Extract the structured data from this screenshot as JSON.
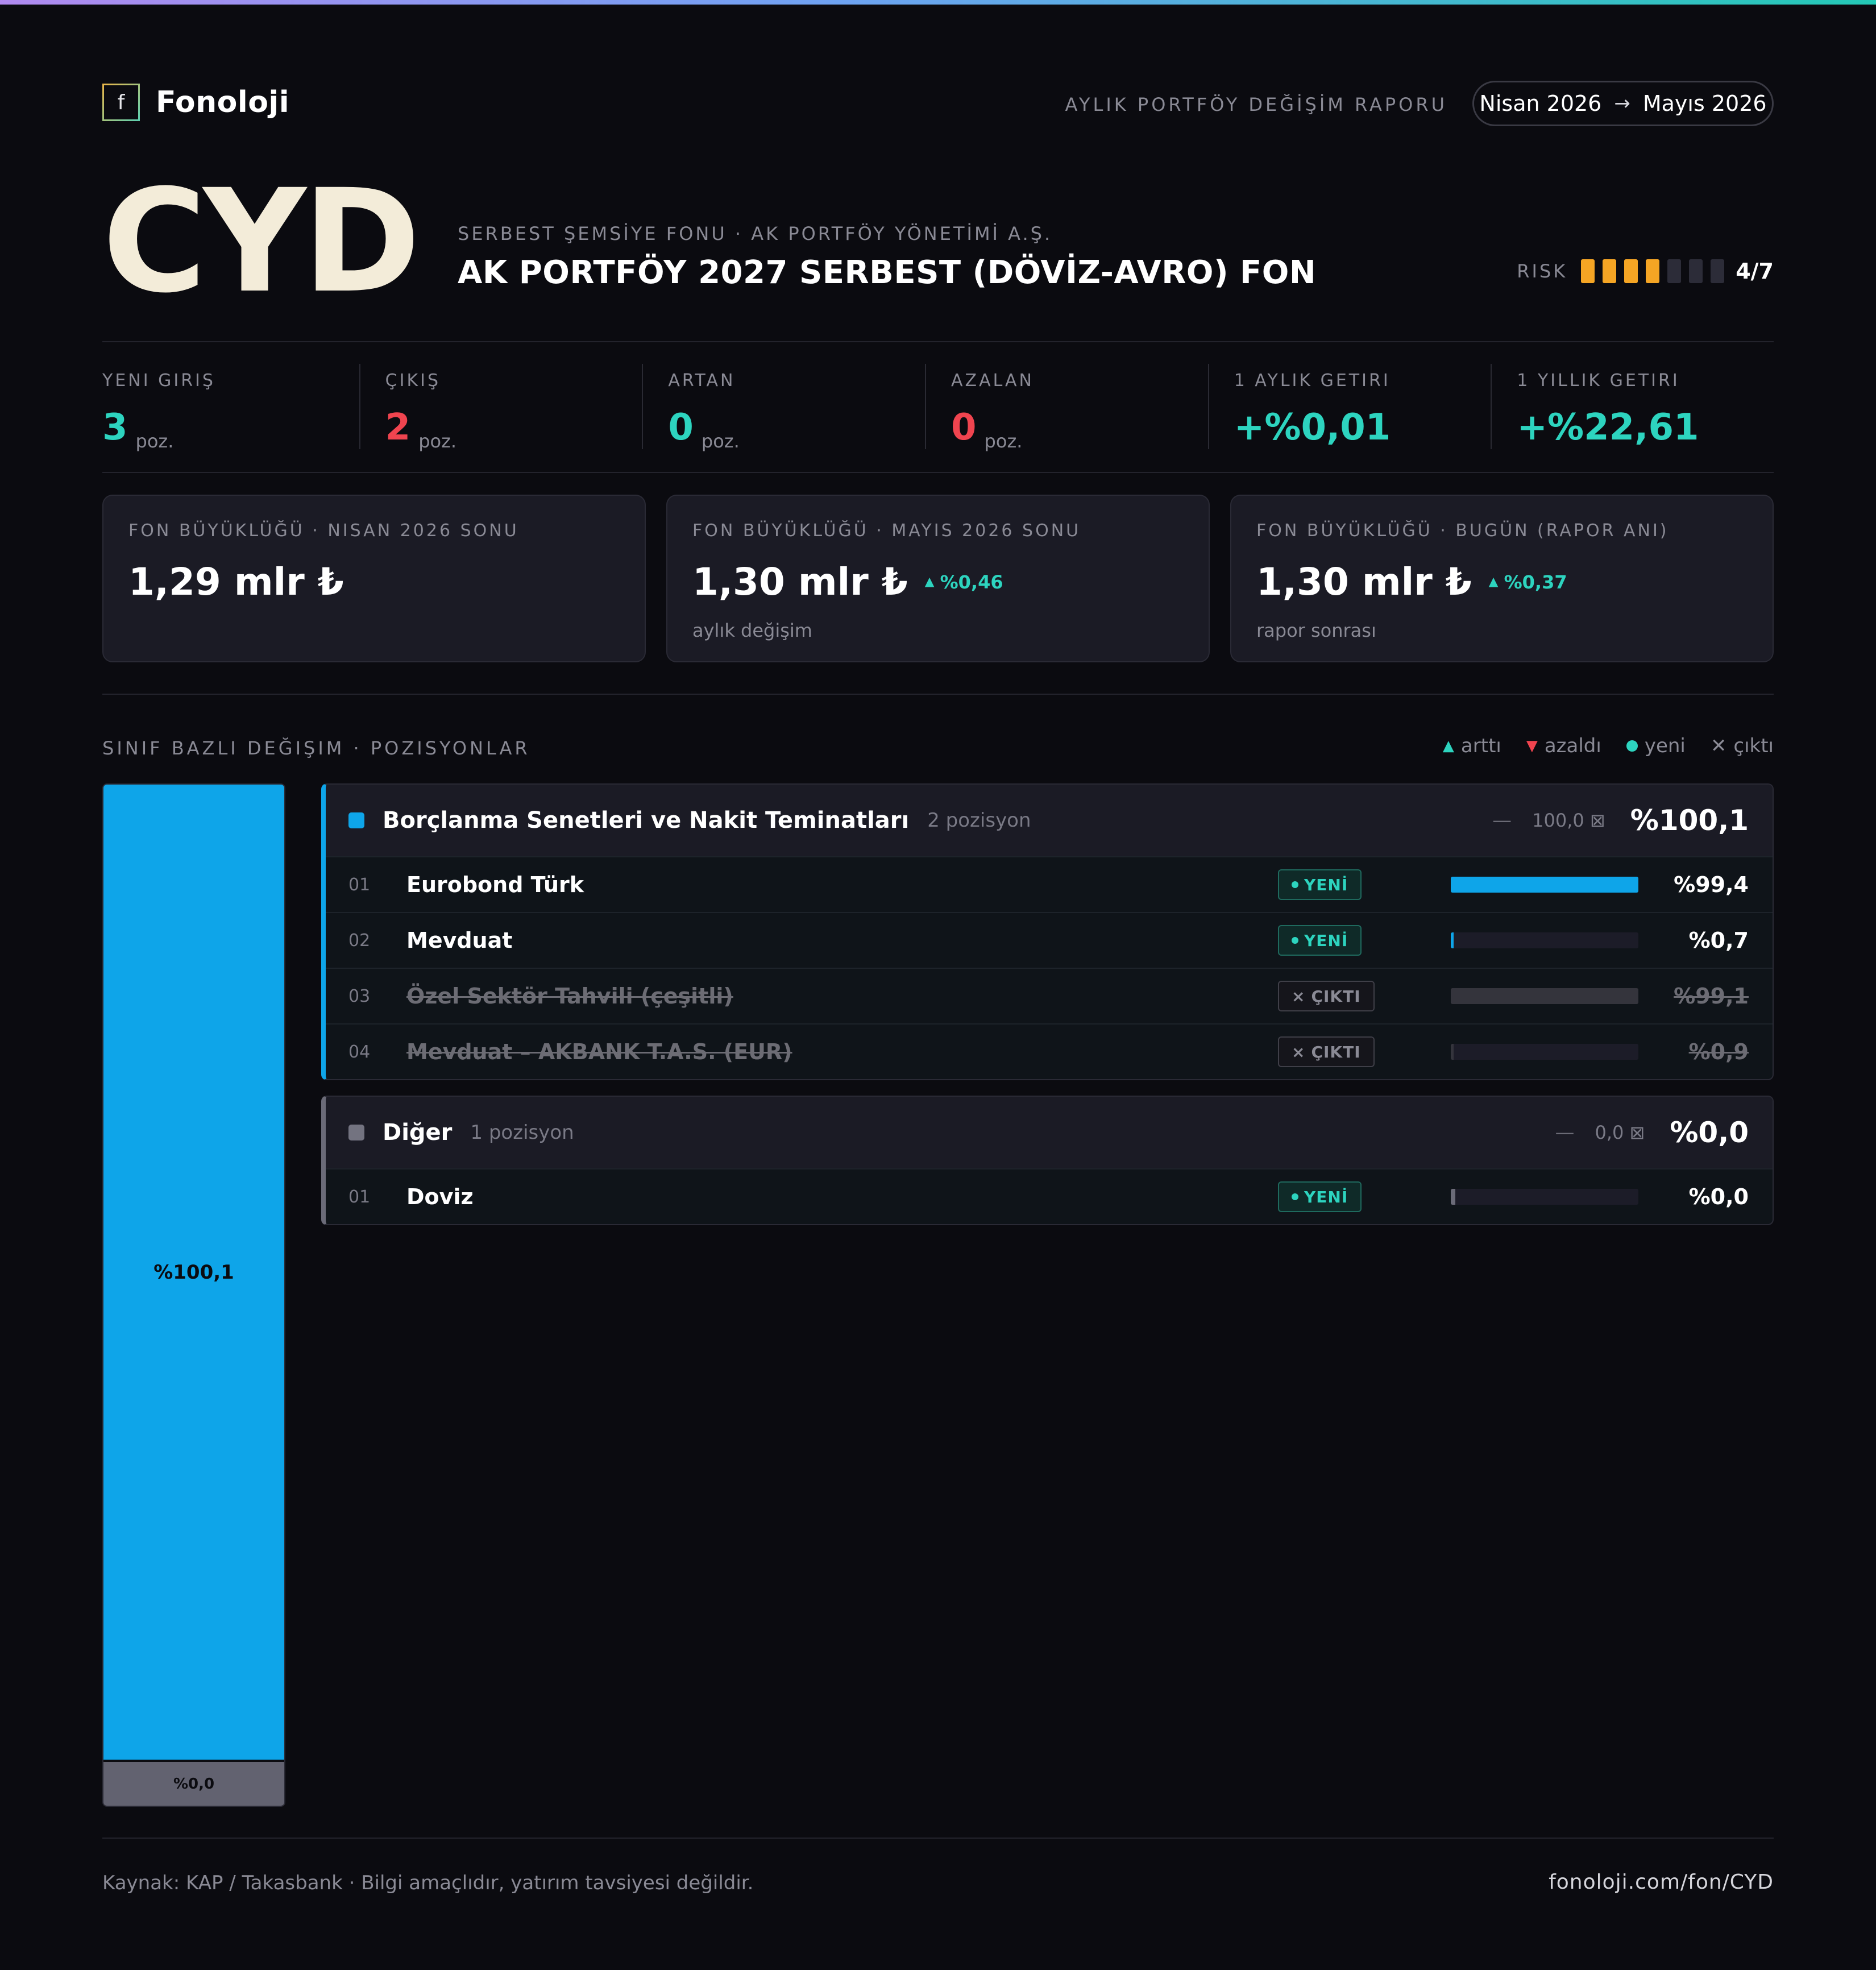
{
  "header": {
    "brand_mark": "f",
    "brand_name": "Fonoloji",
    "report_label": "AYLIK PORTFÖY DEĞİŞİM RAPORU",
    "period_from": "Nisan 2026",
    "period_arrow": "→",
    "period_to": "Mayıs 2026"
  },
  "fund": {
    "ticker": "CYD",
    "subtitle": "SERBEST ŞEMSİYE FONU · AK PORTFÖY YÖNETİMİ A.Ş.",
    "title": "AK PORTFÖY 2027 SERBEST (DÖVİZ-AVRO) FON",
    "risk_label": "RISK",
    "risk_level": 4,
    "risk_max": 7,
    "risk_text": "4/7"
  },
  "colors": {
    "accent_teal": "#2dd4bf",
    "negative_red": "#f0444f",
    "debt_blue": "#0ea5e9",
    "other_gray": "#6b6b78",
    "risk_orange": "#f5a524"
  },
  "stats": [
    {
      "label": "YENI GIRIŞ",
      "value": "3",
      "unit": "poz.",
      "tone": "teal"
    },
    {
      "label": "ÇIKIŞ",
      "value": "2",
      "unit": "poz.",
      "tone": "red"
    },
    {
      "label": "ARTAN",
      "value": "0",
      "unit": "poz.",
      "tone": "teal"
    },
    {
      "label": "AZALAN",
      "value": "0",
      "unit": "poz.",
      "tone": "red"
    },
    {
      "label": "1 AYLIK GETIRI",
      "value": "+%0,01",
      "unit": "",
      "tone": "teal"
    },
    {
      "label": "1 YILLIK GETIRI",
      "value": "+%22,61",
      "unit": "",
      "tone": "teal"
    }
  ],
  "size_cards": [
    {
      "label": "FON BÜYÜKLÜĞÜ · NISAN 2026 SONU",
      "value": "1,29 mlr ₺",
      "change_icon": "",
      "change": "",
      "note": ""
    },
    {
      "label": "FON BÜYÜKLÜĞÜ · MAYIS 2026 SONU",
      "value": "1,30 mlr ₺",
      "change_icon": "▲",
      "change": "%0,46",
      "note": "aylık değişim"
    },
    {
      "label": "FON BÜYÜKLÜĞÜ · BUGÜN (RAPOR ANI)",
      "value": "1,30 mlr ₺",
      "change_icon": "▲",
      "change": "%0,37",
      "note": "rapor sonrası"
    }
  ],
  "section": {
    "title": "SINIF BAZLI DEĞIŞIM · POZISYONLAR",
    "legend": {
      "up_icon": "▲",
      "up": "arttı",
      "down_icon": "▼",
      "down": "azaldı",
      "new": "yeni",
      "exit_icon": "✕",
      "exit": "çıktı"
    }
  },
  "allocation": [
    {
      "label": "%100,1",
      "share": 0.955
    },
    {
      "label": "%0,0",
      "share": 0.045
    }
  ],
  "groups": [
    {
      "name": "Borçlanma Senetleri ve Nakit Teminatları",
      "count": "2 pozisyon",
      "dash": "—",
      "prev": "100,0 ⊠",
      "total": "%100,1",
      "rows": [
        {
          "idx": "01",
          "name": "Eurobond Türk",
          "badge_icon": "●",
          "badge": "YENİ",
          "value": "%99,4",
          "bar_level": 1.0
        },
        {
          "idx": "02",
          "name": "Mevduat",
          "badge_icon": "●",
          "badge": "YENİ",
          "value": "%0,7",
          "bar_level": 0.01
        },
        {
          "idx": "03",
          "name": "Özel Sektör Tahvili (çeşitli)",
          "badge_icon": "×",
          "badge": "ÇIKTI",
          "value": "%99,1",
          "bar_level": 1.0
        },
        {
          "idx": "04",
          "name": "Mevduat – AKBANK T.A.S. (EUR)",
          "badge_icon": "×",
          "badge": "ÇIKTI",
          "value": "%0,9",
          "bar_level": 0.01
        }
      ]
    },
    {
      "name": "Diğer",
      "count": "1 pozisyon",
      "dash": "—",
      "prev": "0,0 ⊠",
      "total": "%0,0",
      "rows": [
        {
          "idx": "01",
          "name": "Doviz",
          "badge_icon": "●",
          "badge": "YENİ",
          "value": "%0,0",
          "bar_level": 0.0
        }
      ]
    }
  ],
  "footer": {
    "source": "Kaynak: KAP / Takasbank · Bilgi amaçlıdır, yatırım tavsiyesi değildir.",
    "url": "fonoloji.com/fon/CYD"
  }
}
